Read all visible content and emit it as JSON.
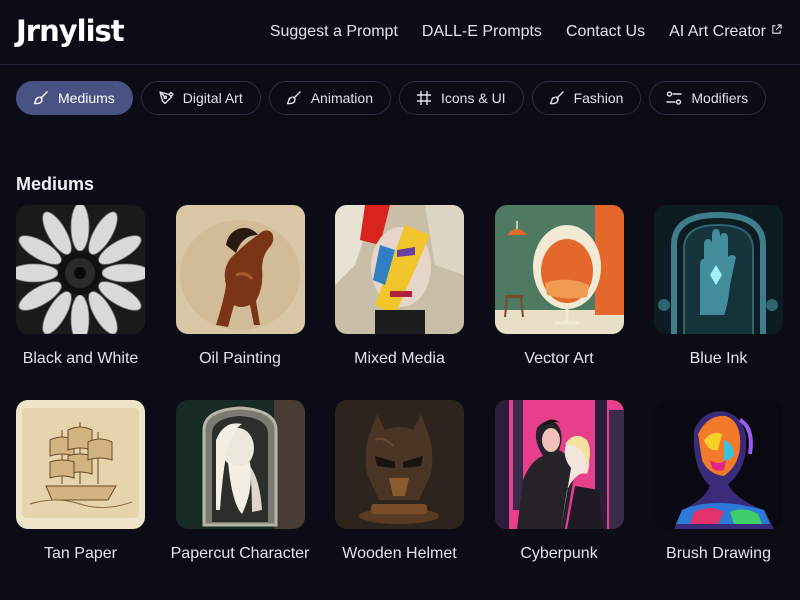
{
  "header": {
    "logo": "Jrnylist",
    "nav": [
      {
        "label": "Suggest a Prompt"
      },
      {
        "label": "DALL-E Prompts"
      },
      {
        "label": "Contact Us"
      },
      {
        "label": "AI Art Creator",
        "icon": "external-link-icon"
      }
    ]
  },
  "categories": [
    {
      "label": "Mediums",
      "icon": "brush-icon",
      "active": true
    },
    {
      "label": "Digital Art",
      "icon": "pen-nib-icon"
    },
    {
      "label": "Animation",
      "icon": "brush-icon"
    },
    {
      "label": "Icons & UI",
      "icon": "frame-icon"
    },
    {
      "label": "Fashion",
      "icon": "brush-icon"
    },
    {
      "label": "Modifiers",
      "icon": "sliders-icon"
    }
  ],
  "section": {
    "title": "Mediums",
    "items": [
      {
        "label": "Black and White",
        "image": "sunflower-image"
      },
      {
        "label": "Oil Painting",
        "image": "horse-image"
      },
      {
        "label": "Mixed Media",
        "image": "face-collage-image"
      },
      {
        "label": "Vector Art",
        "image": "egg-chair-image"
      },
      {
        "label": "Blue Ink",
        "image": "ink-hand-image"
      },
      {
        "label": "Tan Paper",
        "image": "ship-sketch-image"
      },
      {
        "label": "Papercut Character",
        "image": "papercut-wizard-image"
      },
      {
        "label": "Wooden Helmet",
        "image": "helmet-image"
      },
      {
        "label": "Cyberpunk",
        "image": "cyberpunk-couple-image"
      },
      {
        "label": "Brush Drawing",
        "image": "neon-portrait-image"
      }
    ]
  },
  "colors": {
    "background": "#0b0c16",
    "active_chip": "#495383",
    "border": "#2b2d45"
  }
}
